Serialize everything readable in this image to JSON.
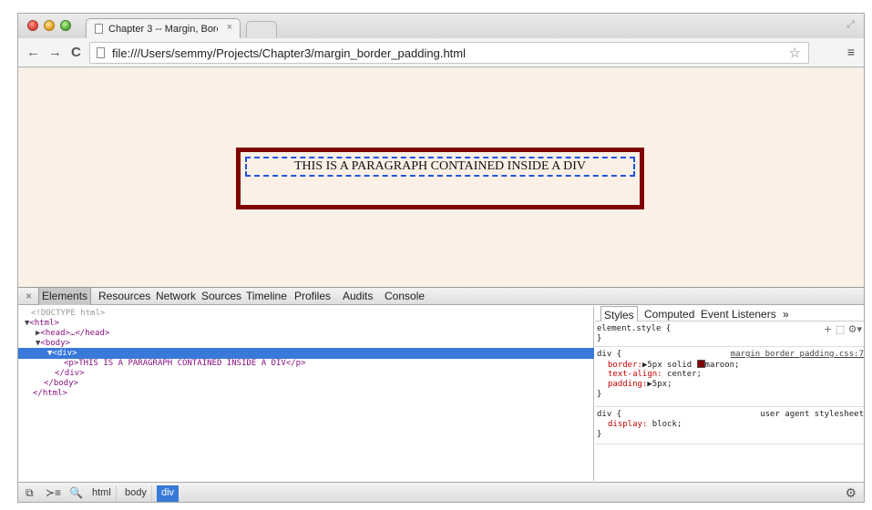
{
  "browser": {
    "tab_title": "Chapter 3 -- Margin, Bord",
    "tab_close": "×",
    "url": "file:///Users/semmy/Projects/Chapter3/margin_border_padding.html",
    "nav": {
      "back": "←",
      "forward": "→",
      "reload": "C"
    },
    "star": "☆",
    "menu": "≡",
    "restore": "⤢"
  },
  "page": {
    "paragraph_text": "THIS IS A PARAGRAPH CONTAINED INSIDE A DIV",
    "background_color": "#faf0e6",
    "border_color": "#800000",
    "dashed_outline_color": "#2255dd"
  },
  "devtools": {
    "close": "×",
    "tabs": [
      "Elements",
      "Resources",
      "Network",
      "Sources",
      "Timeline",
      "Profiles",
      "Audits",
      "Console"
    ],
    "dom": {
      "doctype": "<!DOCTYPE html>",
      "html_open": "<html>",
      "head": "<head>…</head>",
      "body_open": "<body>",
      "div_open": "<div>",
      "p_line": "<p>THIS IS A PARAGRAPH CONTAINED INSIDE A DIV</p>",
      "div_close": "</div>",
      "body_close": "</body>",
      "html_close": "</html>"
    },
    "styles_tabs": [
      "Styles",
      "Computed",
      "Event Listeners",
      "»"
    ],
    "style_tools": "+ ⬚ ⚙▾",
    "rules": {
      "element_style": "element.style {",
      "close_brace": "}",
      "div_selector": "div {",
      "div_source": "margin_border_padding.css:7",
      "border_name": "border:",
      "border_value": "▶5px solid",
      "border_color_name": "maroon;",
      "text_align_name": "text-align:",
      "text_align_value": "center;",
      "padding_name": "padding:",
      "padding_value": "▶5px;",
      "ua_source": "user agent stylesheet",
      "display_name": "display:",
      "display_value": "block;"
    },
    "breadcrumbs": [
      "html",
      "body",
      "div"
    ],
    "status_icons": {
      "dock": "⧉",
      "console": "≻≡",
      "search": "🔍",
      "settings": "⚙"
    }
  },
  "colors": {
    "selection": "#3879d9",
    "tag": "#881280",
    "prop": "#c80000"
  }
}
